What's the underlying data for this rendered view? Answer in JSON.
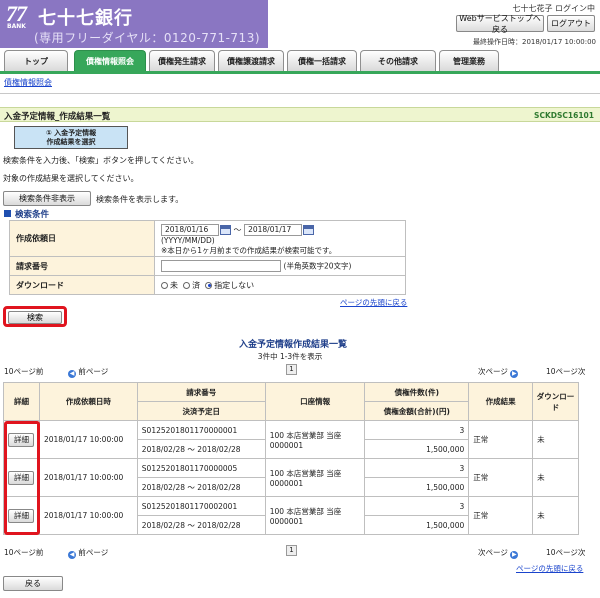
{
  "header": {
    "logo_number": "77",
    "logo_bank": "BANK",
    "logo_name": "七十七銀行",
    "phone": "(専用フリーダイヤル：0120-771-713)",
    "user": "七十七花子 ログイン中",
    "btn_top": "Webサービストップへ戻る",
    "btn_logout": "ログアウト",
    "last_login": "最終操作日時：2018/01/17 10:00:00"
  },
  "nav": {
    "tabs": [
      "トップ",
      "債権情報照会",
      "債権発生請求",
      "債権譲渡請求",
      "債権一括請求",
      "その他請求",
      "管理業務"
    ]
  },
  "subnav": {
    "item": "債権情報照会"
  },
  "page": {
    "title": "入金予定情報_作成結果一覧",
    "screen_id": "SCKDSC16101",
    "step": "① 入金予定情報\n作成結果を選択",
    "inst1": "検索条件を入力後、「検索」ボタンを押してください。",
    "inst2": "対象の作成結果を選択してください。",
    "toggle_btn": "検索条件非表示",
    "toggle_hint": "検索条件を表示します。",
    "section": "検索条件"
  },
  "form": {
    "date_label": "作成依頼日",
    "date_from": "2018/01/16",
    "tilde": "～",
    "date_to": "2018/01/17",
    "date_format": "(YYYY/MM/DD)",
    "date_note": "※本日から1ヶ月前までの作成結果が検索可能です。",
    "invoice_label": "請求番号",
    "invoice_note": "(半角英数字20文字)",
    "download_label": "ダウンロード",
    "radio_options": [
      "未",
      "済",
      "指定しない"
    ],
    "top_link": "ページの先頭に戻る",
    "search_btn": "検索"
  },
  "results": {
    "title": "入金予定情報作成結果一覧",
    "count": "3件中 1-3件を表示",
    "prev10": "10ページ前",
    "prev": "前ページ",
    "page": "1",
    "next": "次ページ",
    "next10": "10ページ次",
    "headers": {
      "detail": "詳細",
      "req_date": "作成依頼日時",
      "invoice": "請求番号",
      "settle": "決済予定日",
      "account": "口座情報",
      "count": "債権件数(件)",
      "amount": "債権金額(合計)(円)",
      "result": "作成結果",
      "download": "ダウンロード"
    },
    "rows": [
      {
        "detail": "詳細",
        "req_date": "2018/01/17 10:00:00",
        "invoice": "S0125201801170000001",
        "settle": "2018/02/28 ～ 2018/02/28",
        "account": "100 本店営業部 当座 0000001",
        "count": "3",
        "amount": "1,500,000",
        "result": "正常",
        "download": "未"
      },
      {
        "detail": "詳細",
        "req_date": "2018/01/17 10:00:00",
        "invoice": "S0125201801170000005",
        "settle": "2018/02/28 ～ 2018/02/28",
        "account": "100 本店営業部 当座 0000001",
        "count": "3",
        "amount": "1,500,000",
        "result": "正常",
        "download": "未"
      },
      {
        "detail": "詳細",
        "req_date": "2018/01/17 10:00:00",
        "invoice": "S0125201801170002001",
        "settle": "2018/02/28 ～ 2018/02/28",
        "account": "100 本店営業部 当座 0000001",
        "count": "3",
        "amount": "1,500,000",
        "result": "正常",
        "download": "未"
      }
    ],
    "top_link": "ページの先頭に戻る",
    "back_btn": "戻る"
  }
}
